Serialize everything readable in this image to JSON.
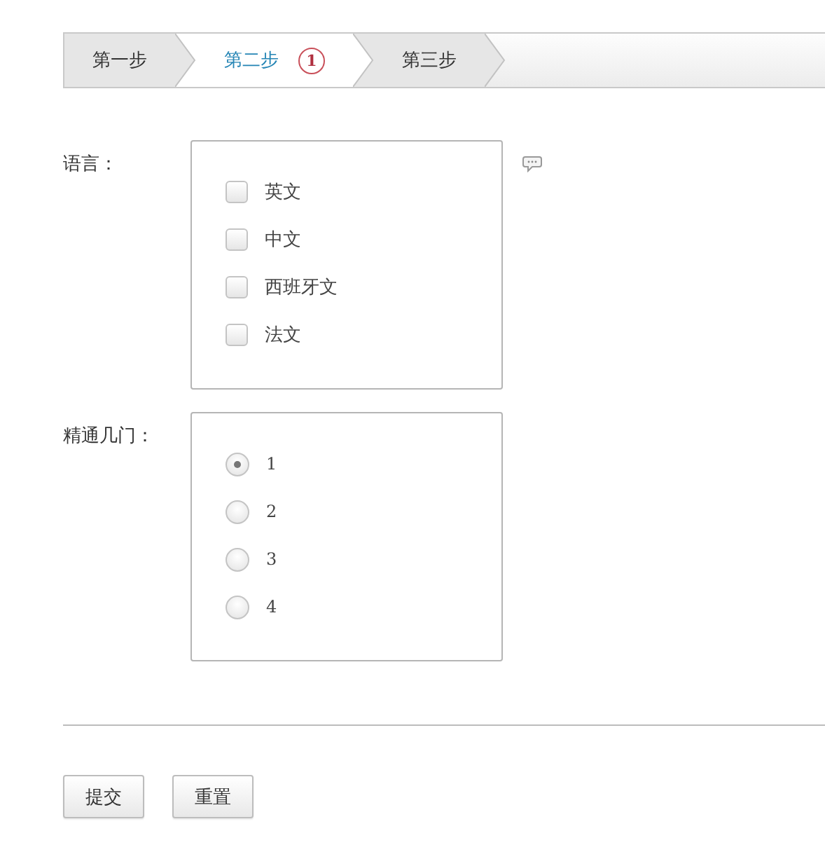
{
  "steps": [
    {
      "label": "第一步",
      "selected": false
    },
    {
      "label": "第二步",
      "selected": true,
      "badge": "1"
    },
    {
      "label": "第三步",
      "selected": false
    }
  ],
  "fields": [
    {
      "label": "语言：",
      "kind": "checkbox",
      "hint": true,
      "options": [
        {
          "label": "英文",
          "checked": false
        },
        {
          "label": "中文",
          "checked": false
        },
        {
          "label": "西班牙文",
          "checked": false
        },
        {
          "label": "法文",
          "checked": false
        }
      ]
    },
    {
      "label": "精通几门：",
      "kind": "radio",
      "hint": false,
      "options": [
        {
          "label": "1",
          "selected": true
        },
        {
          "label": "2",
          "selected": false
        },
        {
          "label": "3",
          "selected": false
        },
        {
          "label": "4",
          "selected": false
        }
      ]
    }
  ],
  "buttons": [
    "提交",
    "重置"
  ]
}
